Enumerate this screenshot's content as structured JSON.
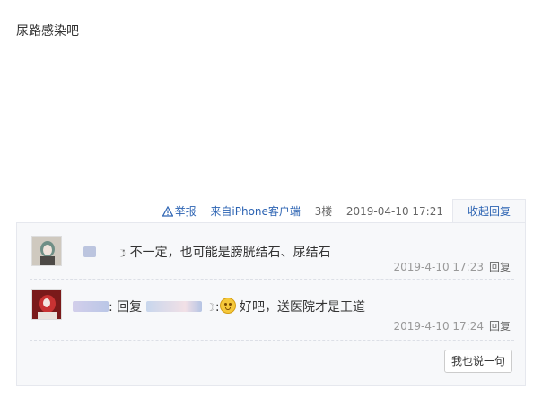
{
  "post": {
    "content": "尿路感染吧"
  },
  "meta": {
    "report_label": "举报",
    "client_label": "来自iPhone客户端",
    "floor_label": "3楼",
    "timestamp": "2019-04-10 17:21",
    "collapse_label": "收起回复"
  },
  "replies": [
    {
      "text": "不一定，也可能是膀胱结石、尿结石",
      "time": "2019-4-10 17:23",
      "reply_label": "回复"
    },
    {
      "reply_word": "回复",
      "text": "好吧，送医院才是王道",
      "time": "2019-4-10 17:24",
      "reply_label": "回复"
    }
  ],
  "composer": {
    "button_label": "我也说一句"
  }
}
